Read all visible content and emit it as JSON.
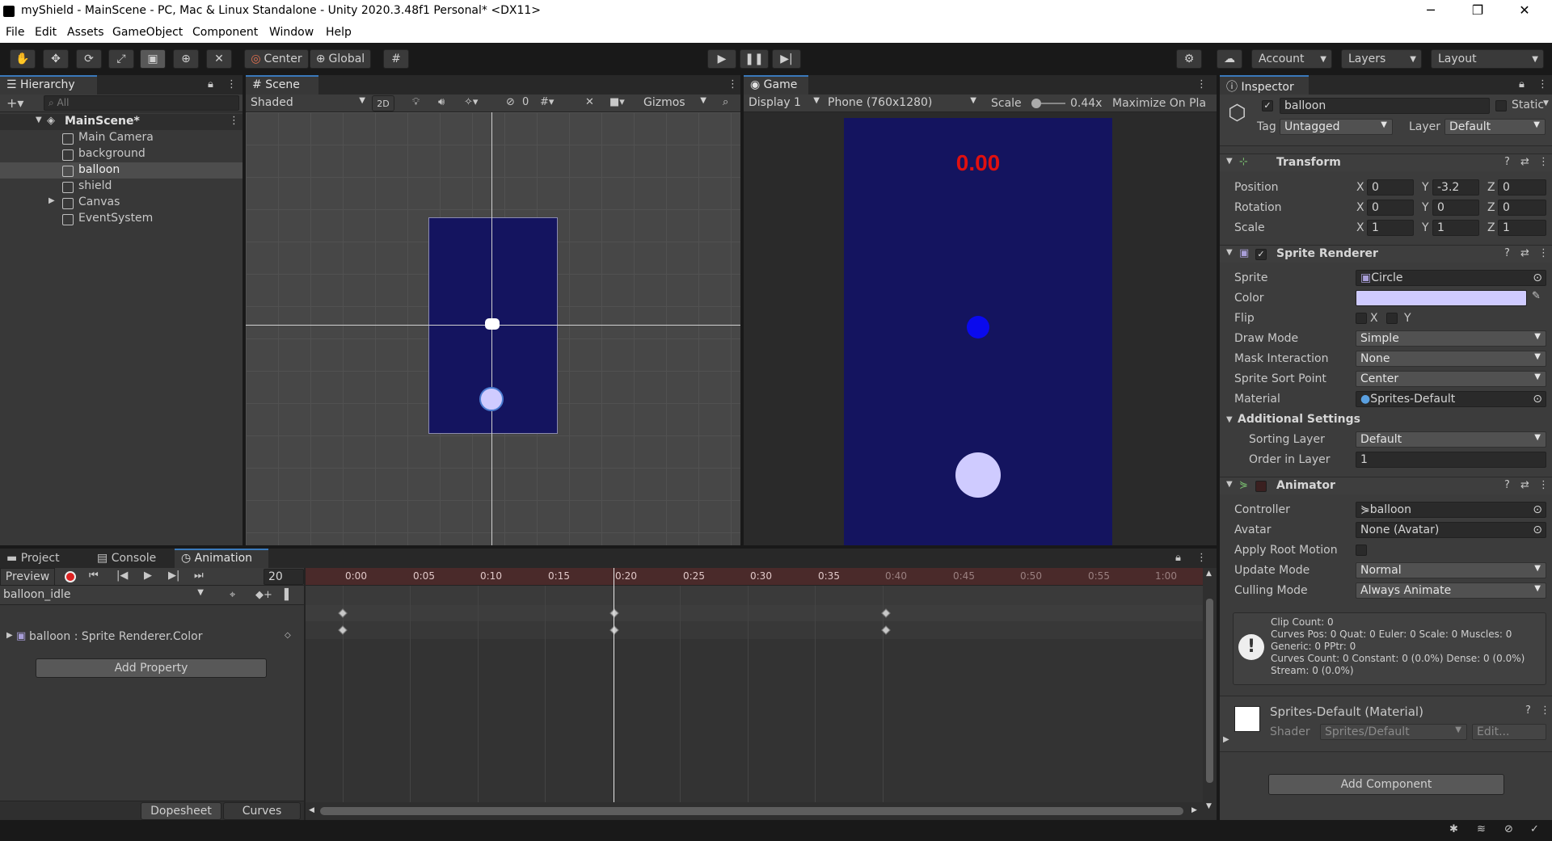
{
  "window": {
    "title": "myShield - MainScene - PC, Mac & Linux Standalone - Unity 2020.3.48f1 Personal* <DX11>",
    "minimize": "─",
    "maximize": "❐",
    "close": "✕"
  },
  "menu": [
    "File",
    "Edit",
    "Assets",
    "GameObject",
    "Component",
    "Window",
    "Help"
  ],
  "toolbar": {
    "pivot": "Center",
    "space": "Global",
    "account": "Account",
    "layers": "Layers",
    "layout": "Layout"
  },
  "hierarchy": {
    "tab": "Hierarchy",
    "search_placeholder": "All",
    "scene": "MainScene*",
    "items": [
      "Main Camera",
      "background",
      "balloon",
      "shield",
      "Canvas",
      "EventSystem"
    ]
  },
  "scene": {
    "tab": "Scene",
    "shading": "Shaded",
    "mode_2d": "2D",
    "hidden_count": "0",
    "gizmos": "Gizmos"
  },
  "game": {
    "tab": "Game",
    "display": "Display 1",
    "resolution": "Phone (760x1280)",
    "scale_label": "Scale",
    "scale_value": "0.44x",
    "maximize": "Maximize On Pla",
    "score": "0.00",
    "colors": {
      "background": "#14145f",
      "score": "#e01010",
      "ball": "#0a0aee",
      "balloon": "#cfcbff"
    }
  },
  "bottom_tabs": [
    "Project",
    "Console",
    "Animation"
  ],
  "animation": {
    "preview": "Preview",
    "frame": "20",
    "clip": "balloon_idle",
    "property": "balloon : Sprite Renderer.Color",
    "add_property": "Add Property",
    "time_labels": [
      "0:00",
      "0:05",
      "0:10",
      "0:15",
      "0:20",
      "0:25",
      "0:30",
      "0:35",
      "0:40",
      "0:45",
      "0:50",
      "0:55",
      "1:00"
    ],
    "dopesheet": "Dopesheet",
    "curves": "Curves"
  },
  "inspector": {
    "tab": "Inspector",
    "object_name": "balloon",
    "static": "Static",
    "tag_label": "Tag",
    "tag": "Untagged",
    "layer_label": "Layer",
    "layer": "Default",
    "transform": {
      "title": "Transform",
      "rows": [
        {
          "label": "Position",
          "x": "0",
          "y": "-3.2",
          "z": "0"
        },
        {
          "label": "Rotation",
          "x": "0",
          "y": "0",
          "z": "0"
        },
        {
          "label": "Scale",
          "x": "1",
          "y": "1",
          "z": "1"
        }
      ]
    },
    "sprite_renderer": {
      "title": "Sprite Renderer",
      "sprite_label": "Sprite",
      "sprite": "Circle",
      "color_label": "Color",
      "color": "#cfcbff",
      "flip_label": "Flip",
      "flip_x": "X",
      "flip_y": "Y",
      "draw_mode_label": "Draw Mode",
      "draw_mode": "Simple",
      "mask_label": "Mask Interaction",
      "mask": "None",
      "sort_point_label": "Sprite Sort Point",
      "sort_point": "Center",
      "material_label": "Material",
      "material": "Sprites-Default",
      "additional": "Additional Settings",
      "sorting_layer_label": "Sorting Layer",
      "sorting_layer": "Default",
      "order_label": "Order in Layer",
      "order": "1"
    },
    "animator": {
      "title": "Animator",
      "controller_label": "Controller",
      "controller": "balloon",
      "avatar_label": "Avatar",
      "avatar": "None (Avatar)",
      "root_motion_label": "Apply Root Motion",
      "update_label": "Update Mode",
      "update": "Normal",
      "culling_label": "Culling Mode",
      "culling": "Always Animate",
      "info": [
        "Clip Count: 0",
        "Curves Pos: 0 Quat: 0 Euler: 0 Scale: 0 Muscles: 0",
        "Generic: 0 PPtr: 0",
        "Curves Count: 0 Constant: 0 (0.0%) Dense: 0 (0.0%)",
        "Stream: 0 (0.0%)"
      ]
    },
    "material": {
      "title": "Sprites-Default (Material)",
      "shader_label": "Shader",
      "shader": "Sprites/Default",
      "edit": "Edit..."
    },
    "add_component": "Add Component"
  }
}
